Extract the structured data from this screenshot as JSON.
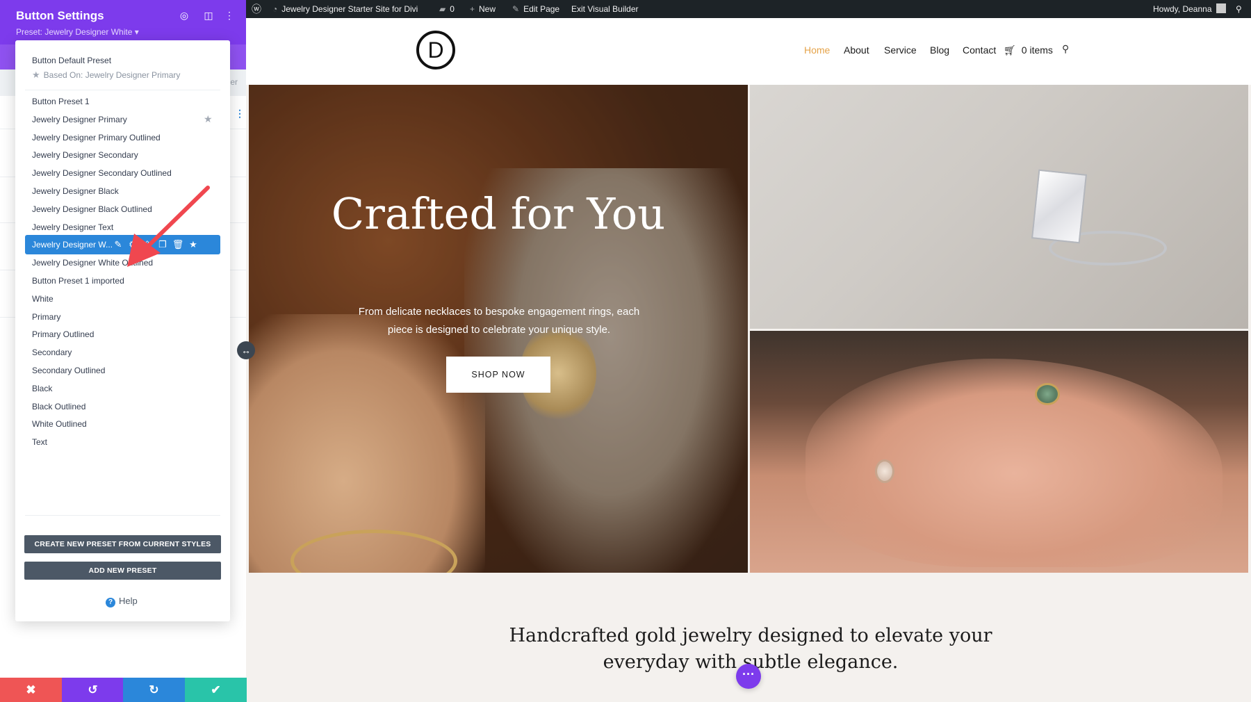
{
  "panel": {
    "title": "Button Settings",
    "preset_label": "Preset: Jewelry Designer White ▾",
    "under_text": "er"
  },
  "dropdown": {
    "default_preset": {
      "name": "Button Default Preset",
      "based_on": "Based On: Jewelry Designer Primary"
    },
    "items": [
      "Button Preset 1",
      "Jewelry Designer Primary",
      "Jewelry Designer Primary Outlined",
      "Jewelry Designer Secondary",
      "Jewelry Designer Secondary Outlined",
      "Jewelry Designer Black",
      "Jewelry Designer Black Outlined",
      "Jewelry Designer Text",
      "Jewelry Designer W...",
      "Jewelry Designer White Outlined",
      "Button Preset 1 imported",
      "White",
      "Primary",
      "Primary Outlined",
      "Secondary",
      "Secondary Outlined",
      "Black",
      "Black Outlined",
      "White Outlined",
      "Text"
    ],
    "active_index": 8,
    "create_button": "CREATE NEW PRESET FROM CURRENT STYLES",
    "add_button": "ADD NEW PRESET",
    "help": "Help"
  },
  "admin_bar": {
    "site_name": "Jewelry Designer Starter Site for Divi",
    "comments": "0",
    "new": "New",
    "edit_page": "Edit Page",
    "exit_builder": "Exit Visual Builder",
    "greeting": "Howdy, Deanna"
  },
  "site": {
    "logo": "D",
    "nav": [
      "Home",
      "About",
      "Service",
      "Blog",
      "Contact"
    ],
    "cart": "0 items",
    "hero_title": "Crafted for You",
    "hero_text": "From delicate necklaces to bespoke engagement rings, each piece is designed to celebrate your unique style.",
    "hero_button": "SHOP NOW",
    "tagline": "Handcrafted gold jewelry designed to elevate your everyday with subtle elegance."
  },
  "colors": {
    "builder_purple": "#7d3bec",
    "active_blue": "#2b87da",
    "cancel_red": "#ef5555",
    "undo_purple": "#7d3bec",
    "redo_blue": "#2b87da",
    "save_green": "#29c4a9",
    "nav_active": "#e5a349",
    "annotation_arrow": "#f0474f"
  },
  "icons": {
    "header": [
      "target-icon",
      "columns-icon",
      "kebab-icon"
    ],
    "active_actions": [
      "pencil-icon",
      "gear-icon",
      "export-icon",
      "duplicate-icon",
      "trash-icon",
      "star-icon"
    ],
    "bottom_bar": [
      "close-icon",
      "undo-icon",
      "redo-icon",
      "check-icon"
    ]
  }
}
